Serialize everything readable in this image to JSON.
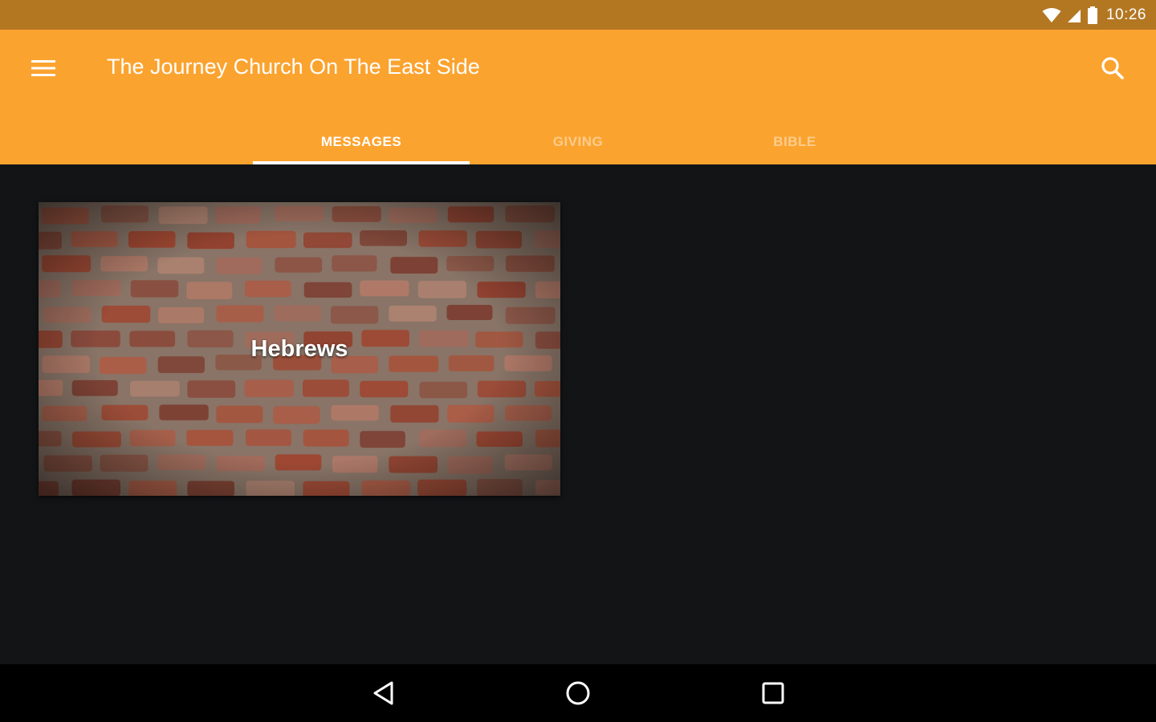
{
  "status_bar": {
    "time": "10:26",
    "icons": [
      "wifi-icon",
      "cell-signal-icon",
      "battery-icon"
    ]
  },
  "app_bar": {
    "title": "The Journey Church On The East Side",
    "menu_icon": "hamburger-menu-icon",
    "search_icon": "search-icon",
    "color": "#fba32f"
  },
  "tabs": [
    {
      "label": "MESSAGES",
      "active": true
    },
    {
      "label": "GIVING",
      "active": false
    },
    {
      "label": "BIBLE",
      "active": false
    }
  ],
  "messages": [
    {
      "title": "Hebrews",
      "image": "brick-wall"
    }
  ],
  "nav_bar": {
    "back_icon": "back-triangle-icon",
    "home_icon": "home-circle-icon",
    "recents_icon": "recents-square-icon"
  },
  "colors": {
    "status_bar": "#b37722",
    "background": "#121416",
    "nav_bar": "#000000"
  }
}
